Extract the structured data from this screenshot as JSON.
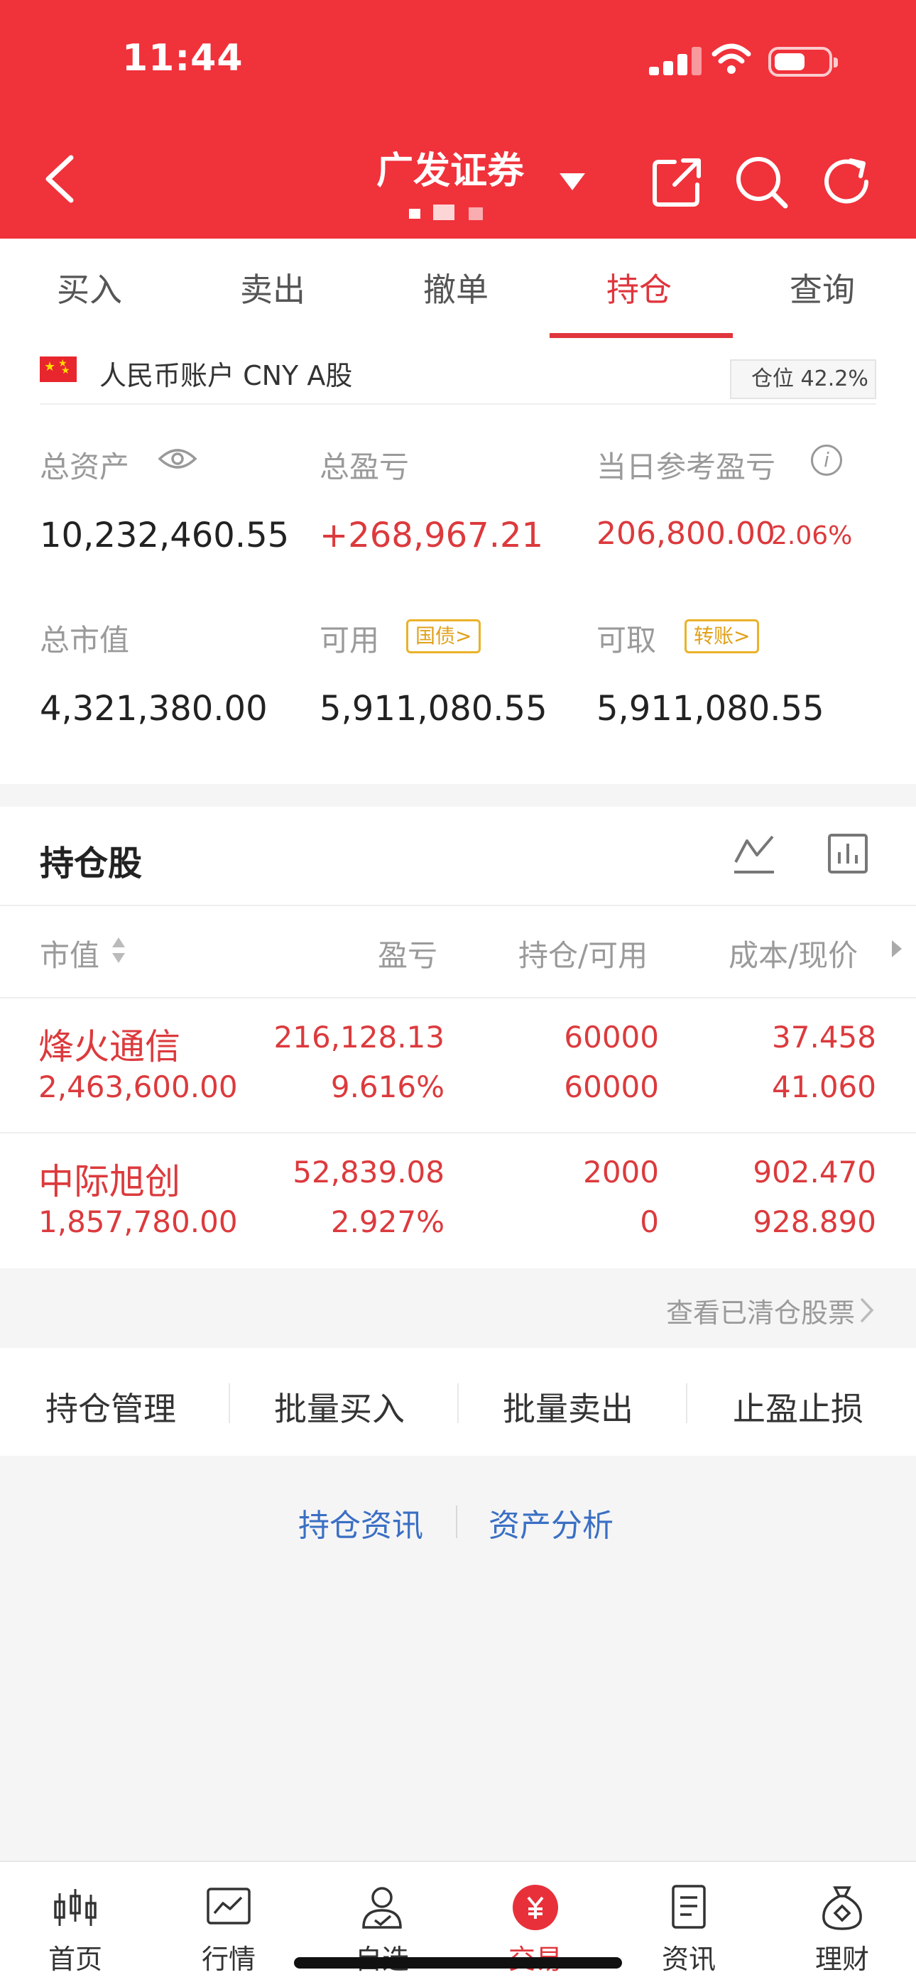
{
  "status_bar": {
    "time": "11:44"
  },
  "header": {
    "title": "广发证券",
    "accent_color": "#f0323b"
  },
  "tabs": [
    {
      "label": "买入"
    },
    {
      "label": "卖出"
    },
    {
      "label": "撤单"
    },
    {
      "label": "持仓",
      "active": true
    },
    {
      "label": "查询"
    }
  ],
  "account": {
    "label": "人民币账户 CNY A股",
    "position_ratio": "仓位 42.2%",
    "total_assets": {
      "label": "总资产",
      "value": "10,232,460.55"
    },
    "total_pnl": {
      "label": "总盈亏",
      "value": "+268,967.21"
    },
    "daily_pnl": {
      "label": "当日参考盈亏",
      "value": "206,800.00",
      "percent": "2.06%"
    },
    "market_value": {
      "label": "总市值",
      "value": "4,321,380.00"
    },
    "available": {
      "label": "可用",
      "tag": "国债>",
      "value": "5,911,080.55"
    },
    "withdrawable": {
      "label": "可取",
      "tag": "转账>",
      "value": "5,911,080.55"
    }
  },
  "holdings": {
    "title": "持仓股",
    "columns": [
      "市值",
      "盈亏",
      "持仓/可用",
      "成本/现价"
    ],
    "rows": [
      {
        "name": "烽火通信",
        "market_value": "2,463,600.00",
        "pnl": "216,128.13",
        "pnl_pct": "9.616%",
        "holding": "60000",
        "available": "60000",
        "cost": "37.458",
        "price": "41.060"
      },
      {
        "name": "中际旭创",
        "market_value": "1,857,780.00",
        "pnl": "52,839.08",
        "pnl_pct": "2.927%",
        "holding": "2000",
        "available": "0",
        "cost": "902.470",
        "price": "928.890"
      }
    ]
  },
  "cleared_link": "查看已清仓股票",
  "actions": [
    "持仓管理",
    "批量买入",
    "批量卖出",
    "止盈止损"
  ],
  "footer_links": [
    "持仓资讯",
    "资产分析"
  ],
  "bottom_nav": [
    {
      "label": "首页",
      "icon": "candlestick-icon"
    },
    {
      "label": "行情",
      "icon": "line-chart-icon"
    },
    {
      "label": "自选",
      "icon": "user-check-icon"
    },
    {
      "label": "交易",
      "icon": "yuan-icon",
      "active": true
    },
    {
      "label": "资讯",
      "icon": "news-icon"
    },
    {
      "label": "理财",
      "icon": "money-bag-icon"
    }
  ]
}
